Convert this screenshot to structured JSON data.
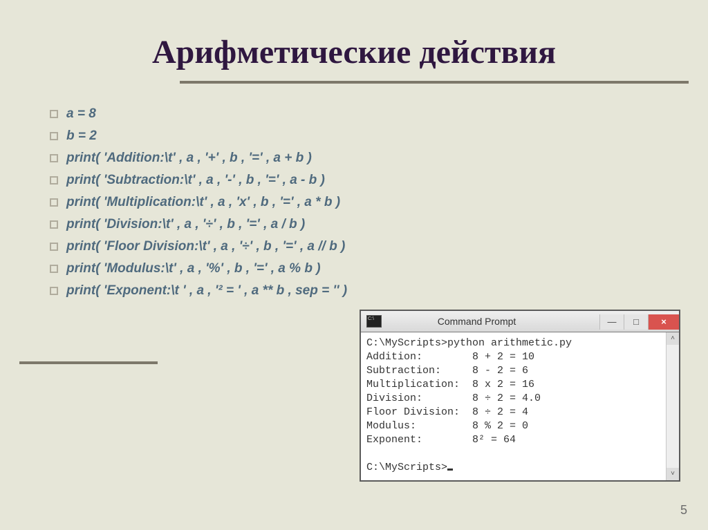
{
  "title": "Арифметические действия",
  "bullets": [
    "a = 8",
    "b = 2",
    "print( 'Addition:\\t' , a , '+' , b , '=' , a + b )",
    "print( 'Subtraction:\\t' , a , '-' , b , '=' , a - b )",
    "print( 'Multiplication:\\t' , a , 'x' , b , '=' , a * b )",
    "print( 'Division:\\t' , a , '÷' , b , '=' , a / b )",
    "print( 'Floor Division:\\t' , a , '÷' , b , '=' , a // b )",
    "print( 'Modulus:\\t' , a , '%' , b , '=' , a % b )",
    "print( 'Exponent:\\t ' , a , '² = ' , a ** b , sep = '' )"
  ],
  "cmd": {
    "title": "Command Prompt",
    "lines": [
      "C:\\MyScripts>python arithmetic.py",
      "Addition:        8 + 2 = 10",
      "Subtraction:     8 - 2 = 6",
      "Multiplication:  8 x 2 = 16",
      "Division:        8 ÷ 2 = 4.0",
      "Floor Division:  8 ÷ 2 = 4",
      "Modulus:         8 % 2 = 0",
      "Exponent:        8² = 64",
      "",
      "C:\\MyScripts>"
    ],
    "min": "—",
    "max": "□",
    "close": "×",
    "scroll_up": "˄",
    "scroll_down": "˅"
  },
  "page": "5"
}
